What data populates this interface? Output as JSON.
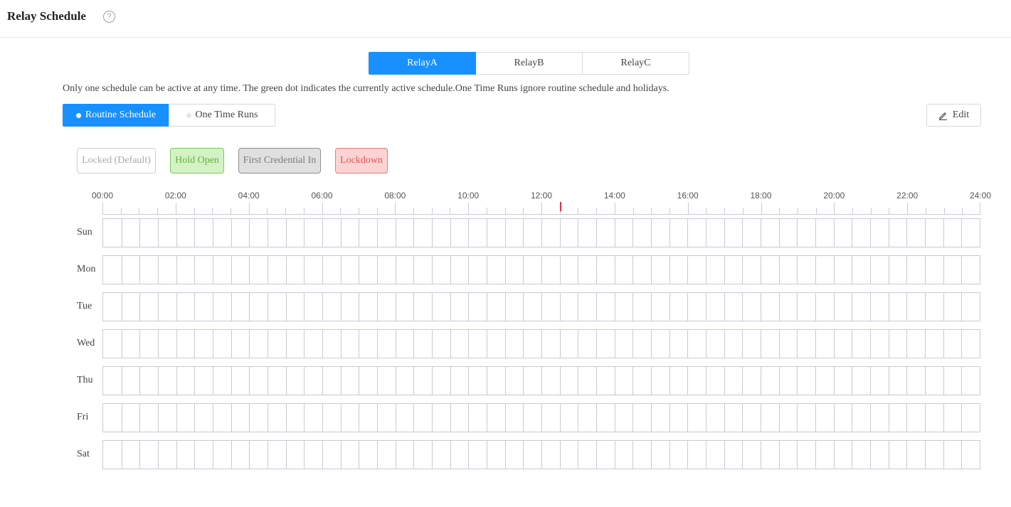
{
  "header": {
    "title": "Relay Schedule",
    "help_icon": "question-circle-icon",
    "help_glyph": "?"
  },
  "relay_tabs": [
    {
      "label": "RelayA",
      "active": true
    },
    {
      "label": "RelayB",
      "active": false
    },
    {
      "label": "RelayC",
      "active": false
    }
  ],
  "notice": "Only one schedule can be active at any time. The green dot indicates the currently active schedule.One Time Runs ignore routine schedule and holidays.",
  "schedule_tabs": [
    {
      "label": "Routine Schedule",
      "active": true,
      "dot_color": "#ffffff"
    },
    {
      "label": "One Time Runs",
      "active": false,
      "dot_color": "#e3e5e8"
    }
  ],
  "edit_button": {
    "label": "Edit",
    "icon": "pencil-icon"
  },
  "legend": [
    {
      "label": "Locked (Default)",
      "name": "locked-default",
      "bg": "#ffffff",
      "border": "#c9cdd4",
      "text": "#a6a9ae"
    },
    {
      "label": "Hold Open",
      "name": "hold-open",
      "bg": "#d4f2c6",
      "border": "#7cc95a",
      "text": "#5fb33d"
    },
    {
      "label": "First Credential In",
      "name": "first-credential-in",
      "bg": "#e0e0e0",
      "border": "#8f8f8f",
      "text": "#7b7b7b"
    },
    {
      "label": "Lockdown",
      "name": "lockdown",
      "bg": "#fcd3d3",
      "border": "#f07a7a",
      "text": "#e25555"
    }
  ],
  "timeline": {
    "labels": [
      "00:00",
      "02:00",
      "04:00",
      "06:00",
      "08:00",
      "10:00",
      "12:00",
      "14:00",
      "16:00",
      "18:00",
      "20:00",
      "22:00",
      "24:00"
    ],
    "hours": 24,
    "slots_per_hour": 4,
    "current_time_marker_color": "#e0314b"
  },
  "days": [
    "Sun",
    "Mon",
    "Tue",
    "Wed",
    "Thu",
    "Fri",
    "Sat"
  ],
  "colors": {
    "accent": "#1890ff",
    "border": "#d9d9d9",
    "grid": "#c6cbd4"
  }
}
